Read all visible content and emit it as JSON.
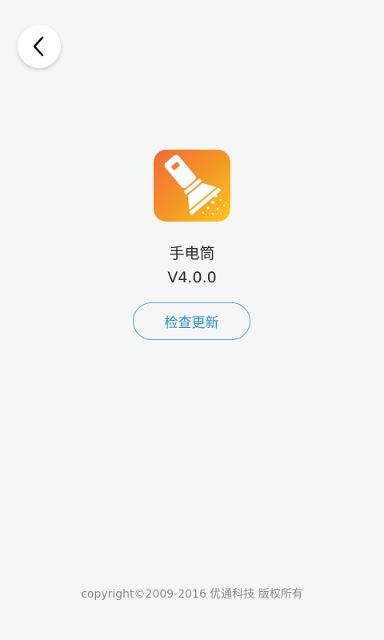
{
  "header": {
    "back_icon": "chevron-left-icon"
  },
  "app": {
    "icon": "flashlight-icon",
    "name": "手电筒",
    "version": "V4.0.0"
  },
  "actions": {
    "check_update_label": "检查更新"
  },
  "footer": {
    "copyright": "copyright©2009-2016 优通科技 版权所有"
  },
  "colors": {
    "background": "#f4f7f6",
    "accent": "#2f8fd0",
    "icon_gradient_start": "#f26a3a",
    "icon_gradient_end": "#ffc51f"
  }
}
